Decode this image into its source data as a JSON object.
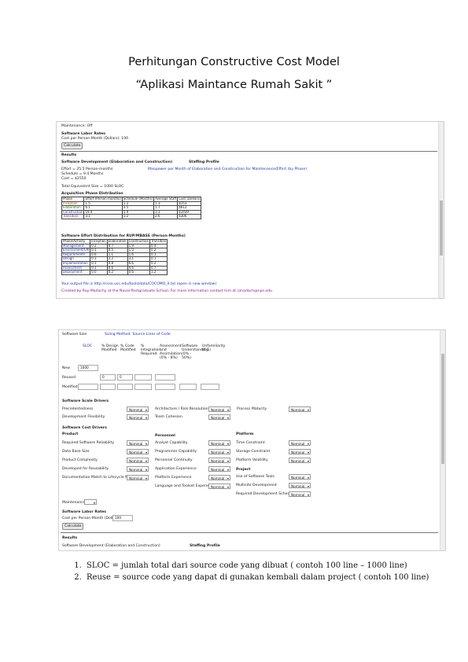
{
  "document": {
    "title_line1": "Perhitungan Constructive Cost Model",
    "title_line2": "“Aplikasi Maintance Rumah Sakit ”"
  },
  "shot1": {
    "maintenance": "Maintenance: Off",
    "section_sloc": "Software Labor Rates",
    "cost_line": "Cost per Person-Month (Dollars): 100",
    "calc": "Calculate",
    "results": "Results",
    "dev_label": "Software Development (Elaboration and Construction)",
    "staffing": "Staffing Profile",
    "effort": "Effort = 25.5 Person-months",
    "schedule": "Schedule = 9.4 Months",
    "cost": "Cost = $2550",
    "total_equiv": "Total Equivalent Size = 1000 SLOC",
    "note_blue": "Manpower per Month of Elaboration and Construction for Maintenance/Effort (by Phase)",
    "acq_title": "Acquisition Phase Distribution",
    "acq_headers": [
      "Phase",
      "Effort (Person-months)",
      "Schedule (Months)",
      "Average Staff",
      "Cost (Dollars)"
    ],
    "acq_rows": [
      [
        "Inception",
        "1.5",
        "1.2",
        "1.3",
        "$153"
      ],
      [
        "Elaboration",
        "6.1",
        "3.5",
        "1.7",
        "$612"
      ],
      [
        "Construction",
        "19.4",
        "5.9",
        "3.3",
        "$1939"
      ],
      [
        "Transition",
        "3.1",
        "1.2",
        "2.6",
        "$306"
      ]
    ],
    "phase_title": "Software Effort Distribution for RUP/MBASE (Person-Months)",
    "phase_headers": [
      "Phase/Activity",
      "Inception",
      "Elaboration",
      "Construction",
      "Transition"
    ],
    "phase_rows": [
      [
        "Management",
        "0.2",
        "0.7",
        "1.9",
        "0.4"
      ],
      [
        "Environment/CM",
        "0.1",
        "0.5",
        "1.0",
        "0.2"
      ],
      [
        "Requirements",
        "0.6",
        "1.1",
        "1.6",
        "0.1"
      ],
      [
        "Design",
        "0.3",
        "2.2",
        "3.1",
        "0.1"
      ],
      [
        "Implementation",
        "0.1",
        "0.8",
        "6.6",
        "0.2"
      ],
      [
        "Assessment",
        "0.1",
        "0.6",
        "4.6",
        "0.7"
      ],
      [
        "Deployment",
        "0.0",
        "0.2",
        "0.6",
        "1.2"
      ]
    ],
    "footer1": "Your output file is http://csse.usc.edu/tools/data/COCOMO_II.txt (open in new window)",
    "footer2": "Created by Ray Madachy at the Naval Postgraduate School. For more information contact him at rjmadach@nps.edu"
  },
  "shot2": {
    "top_label": "Software Size",
    "top_value": "Sizing Method: Source Lines of Code",
    "col_headers": [
      "SLOC",
      "% Design Modified",
      "% Code Modified",
      "% Integration Required",
      "Assessment and Assimilation (0% - 8%)",
      "Software Understanding (0% - 50%)",
      "Unfamiliarity (0-1)"
    ],
    "row_new": "New",
    "row_new_value": "1000",
    "row_reused": "Reused",
    "row_reused_values": [
      "0",
      "0"
    ],
    "row_modified": "Modified",
    "scale_title": "Software Scale Drivers",
    "scale": [
      {
        "label": "Precedentedness",
        "value": "Nominal"
      },
      {
        "label": "Development Flexibility",
        "value": "Nominal"
      },
      {
        "label": "Architecture / Risk Resolution",
        "value": "Nominal"
      },
      {
        "label": "Team Cohesion",
        "value": "Nominal"
      },
      {
        "label": "Process Maturity",
        "value": "Nominal"
      }
    ],
    "cost_title": "Software Cost Drivers",
    "product_title": "Product",
    "product": [
      {
        "label": "Required Software Reliability",
        "value": "Nominal"
      },
      {
        "label": "Data Base Size",
        "value": "Nominal"
      },
      {
        "label": "Product Complexity",
        "value": "Nominal"
      },
      {
        "label": "Developed for Reusability",
        "value": "Nominal"
      },
      {
        "label": "Documentation Match to Lifecycle Needs",
        "value": "Nominal"
      }
    ],
    "personnel_title": "Personnel",
    "personnel": [
      {
        "label": "Analyst Capability",
        "value": "Nominal"
      },
      {
        "label": "Programmer Capability",
        "value": "Nominal"
      },
      {
        "label": "Personnel Continuity",
        "value": "Nominal"
      },
      {
        "label": "Application Experience",
        "value": "Nominal"
      },
      {
        "label": "Platform Experience",
        "value": "Nominal"
      },
      {
        "label": "Language and Toolset Experience",
        "value": "Nominal"
      }
    ],
    "platform_title": "Platform",
    "platform": [
      {
        "label": "Time Constraint",
        "value": "Nominal"
      },
      {
        "label": "Storage Constraint",
        "value": "Nominal"
      },
      {
        "label": "Platform Volatility",
        "value": "Nominal"
      }
    ],
    "project_title": "Project",
    "project": [
      {
        "label": "Use of Software Tools",
        "value": "Nominal"
      },
      {
        "label": "Multisite Development",
        "value": "Nominal"
      },
      {
        "label": "Required Development Schedule",
        "value": "Nominal"
      }
    ],
    "maintenance": "Maintenance: Off",
    "labor_title": "Software Labor Rates",
    "labor_line": "Cost per Person-Month (Dollars)",
    "labor_value": "100",
    "calc": "Calculate",
    "results": "Results",
    "dev_label": "Software Development (Elaboration and Construction)",
    "staffing": "Staffing Profile"
  },
  "notes": [
    "SLOC = jumlah total dari source code yang dibuat ( contoh 100 line – 1000 line)",
    "Reuse = source code yang dapat di gunakan kembali dalam project  ( contoh 100 line)"
  ]
}
